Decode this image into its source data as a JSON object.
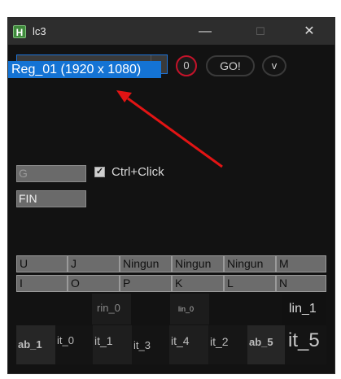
{
  "window": {
    "title": "lc3",
    "app_icon_letter": "H",
    "controls": {
      "minimize": "—",
      "maximize": "☐",
      "close": "✕"
    }
  },
  "toolbar": {
    "dropdown_value": "",
    "dropdown_option": "Reg_01 (1920 x 1080)",
    "counter": "0",
    "go_label": "GO!",
    "v_label": "v"
  },
  "inputs": {
    "g_field": "G",
    "fin_field": "FIN",
    "checkbox_checked": true,
    "checkbox_label": "Ctrl+Click"
  },
  "keys": {
    "row1": [
      "U",
      "J",
      "Ningun",
      "Ningun",
      "Ningun",
      "M"
    ],
    "row2": [
      "I",
      "O",
      "P",
      "K",
      "L",
      "N"
    ]
  },
  "tiles": {
    "rin_0": "rin_0",
    "lin_0": "lin_0",
    "lin_1": "lin_1",
    "ab_1": "ab_1",
    "it_0": "it_0",
    "it_1": "it_1",
    "it_3": "it_3",
    "it_4": "it_4",
    "it_2": "it_2",
    "ab_5": "ab_5",
    "it_5": "it_5"
  },
  "colors": {
    "accent_blue": "#1473d4",
    "counter_ring": "#c4132a",
    "annotation_arrow": "#e21414"
  },
  "icons": [
    "app-icon",
    "minimize-icon",
    "maximize-icon",
    "close-icon",
    "chevron-down-icon",
    "checkmark-icon"
  ]
}
